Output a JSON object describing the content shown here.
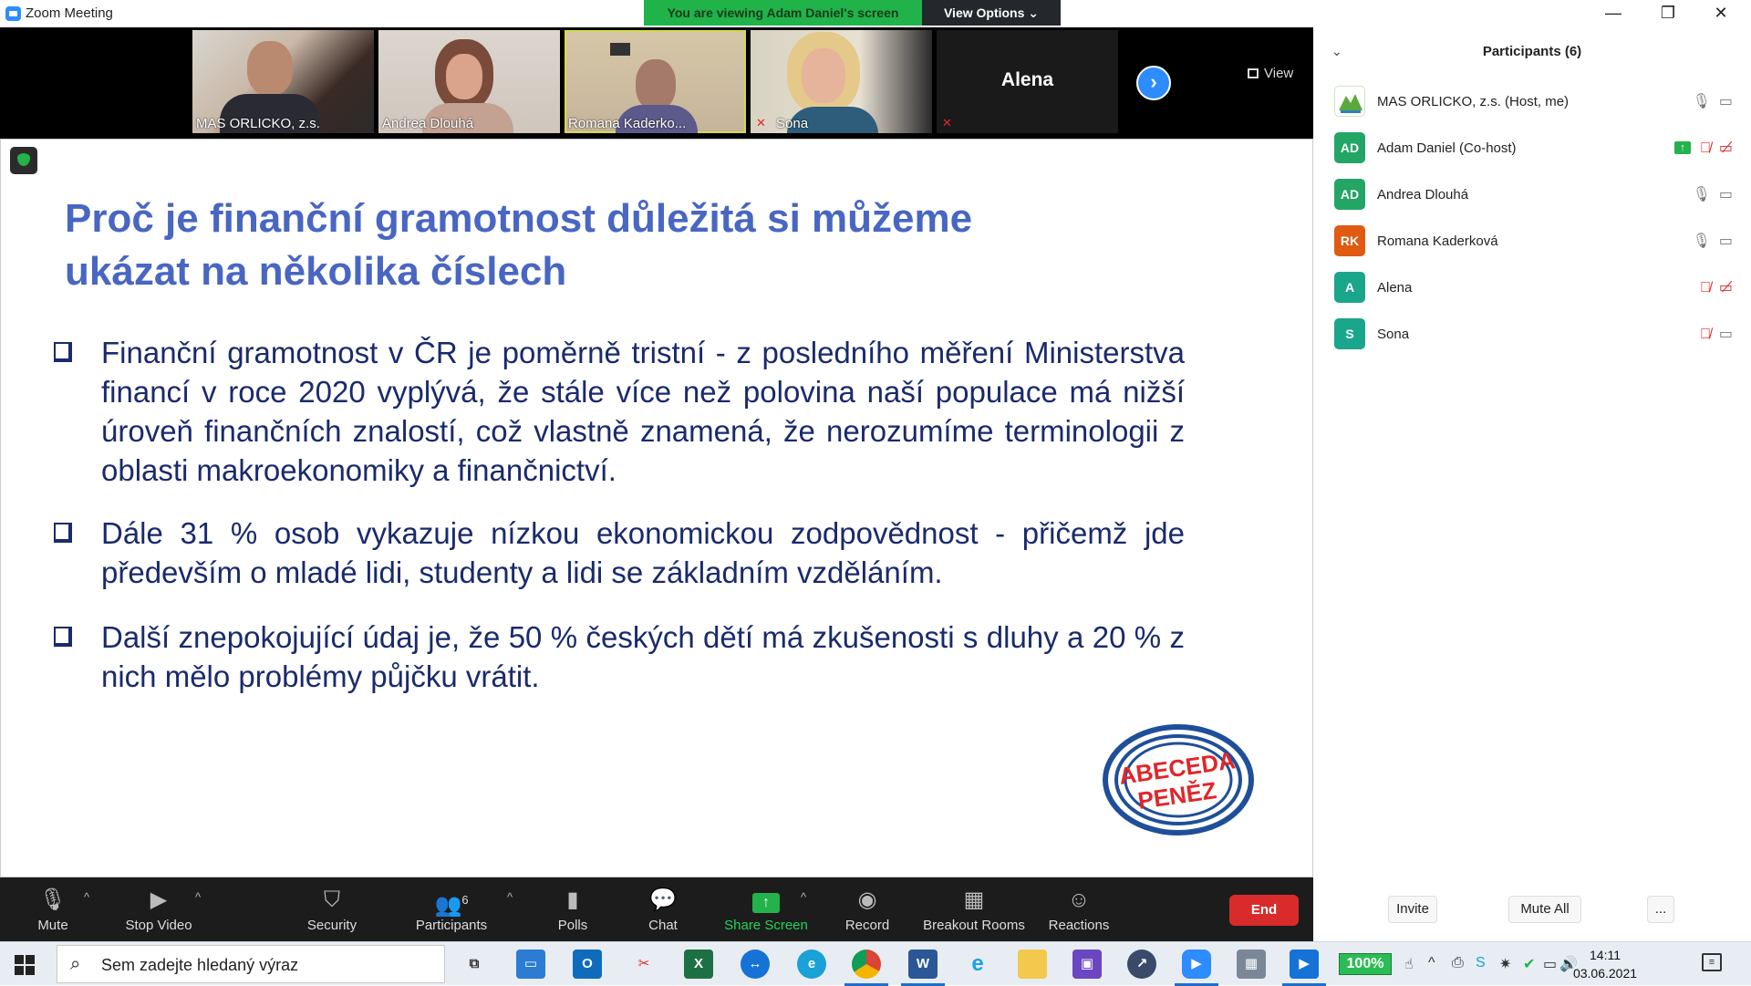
{
  "window": {
    "title": "Zoom Meeting",
    "viewing_banner": "You are viewing Adam Daniel's screen",
    "view_options": "View Options ⌄",
    "minimize": "—",
    "restore": "❐",
    "close": "✕"
  },
  "video_strip": {
    "tiles": [
      {
        "name": "MAS ORLICKO, z.s."
      },
      {
        "name": "Andrea Dlouhá"
      },
      {
        "name": "Romana Kaderko..."
      },
      {
        "name": "Sona"
      },
      {
        "name": "Alena"
      }
    ],
    "view_button": "View"
  },
  "slide": {
    "title": "Proč je finanční gramotnost důležitá si můžeme ukázat na několika číslech",
    "bullets": [
      "Finanční gramotnost v ČR je poměrně tristní - z posledního měření Ministerstva financí v roce 2020 vyplývá, že stále více než polovina naší populace má nižší úroveň finančních znalostí, což vlastně znamená, že nerozumíme terminologii z oblasti makroekonomiky a finančnictví.",
      "Dále 31 % osob vykazuje nízkou ekonomickou zodpovědnost - přičemž jde především o mladé lidi, studenty a lidi se základním vzděláním.",
      "Další znepokojující údaj je, že 50 % českých dětí má zkušenosti s dluhy a 20 % z nich mělo problémy půjčku vrátit."
    ],
    "logo_line1": "ABECEDA",
    "logo_line2": "PENĚZ"
  },
  "toolbar": {
    "mute": "Mute",
    "stop_video": "Stop Video",
    "security": "Security",
    "participants": "Participants",
    "participants_count": "6",
    "polls": "Polls",
    "chat": "Chat",
    "share_screen": "Share Screen",
    "record": "Record",
    "breakout_rooms": "Breakout Rooms",
    "reactions": "Reactions",
    "end": "End"
  },
  "panel": {
    "title": "Participants (6)",
    "participants": [
      {
        "initials": "",
        "name": "MAS ORLICKO, z.s. (Host, me)",
        "color": "#ffffff"
      },
      {
        "initials": "AD",
        "name": "Adam Daniel (Co-host)",
        "color": "#23a565"
      },
      {
        "initials": "AD",
        "name": "Andrea Dlouhá",
        "color": "#23a565"
      },
      {
        "initials": "RK",
        "name": "Romana Kaderková",
        "color": "#e05a12"
      },
      {
        "initials": "A",
        "name": "Alena",
        "color": "#1aa68a"
      },
      {
        "initials": "S",
        "name": "Sona",
        "color": "#1aa68a"
      }
    ],
    "invite": "Invite",
    "mute_all": "Mute All",
    "more": "..."
  },
  "taskbar": {
    "search_placeholder": "Sem zadejte hledaný výraz",
    "battery": "100%",
    "time": "14:11",
    "date": "03.06.2021"
  }
}
